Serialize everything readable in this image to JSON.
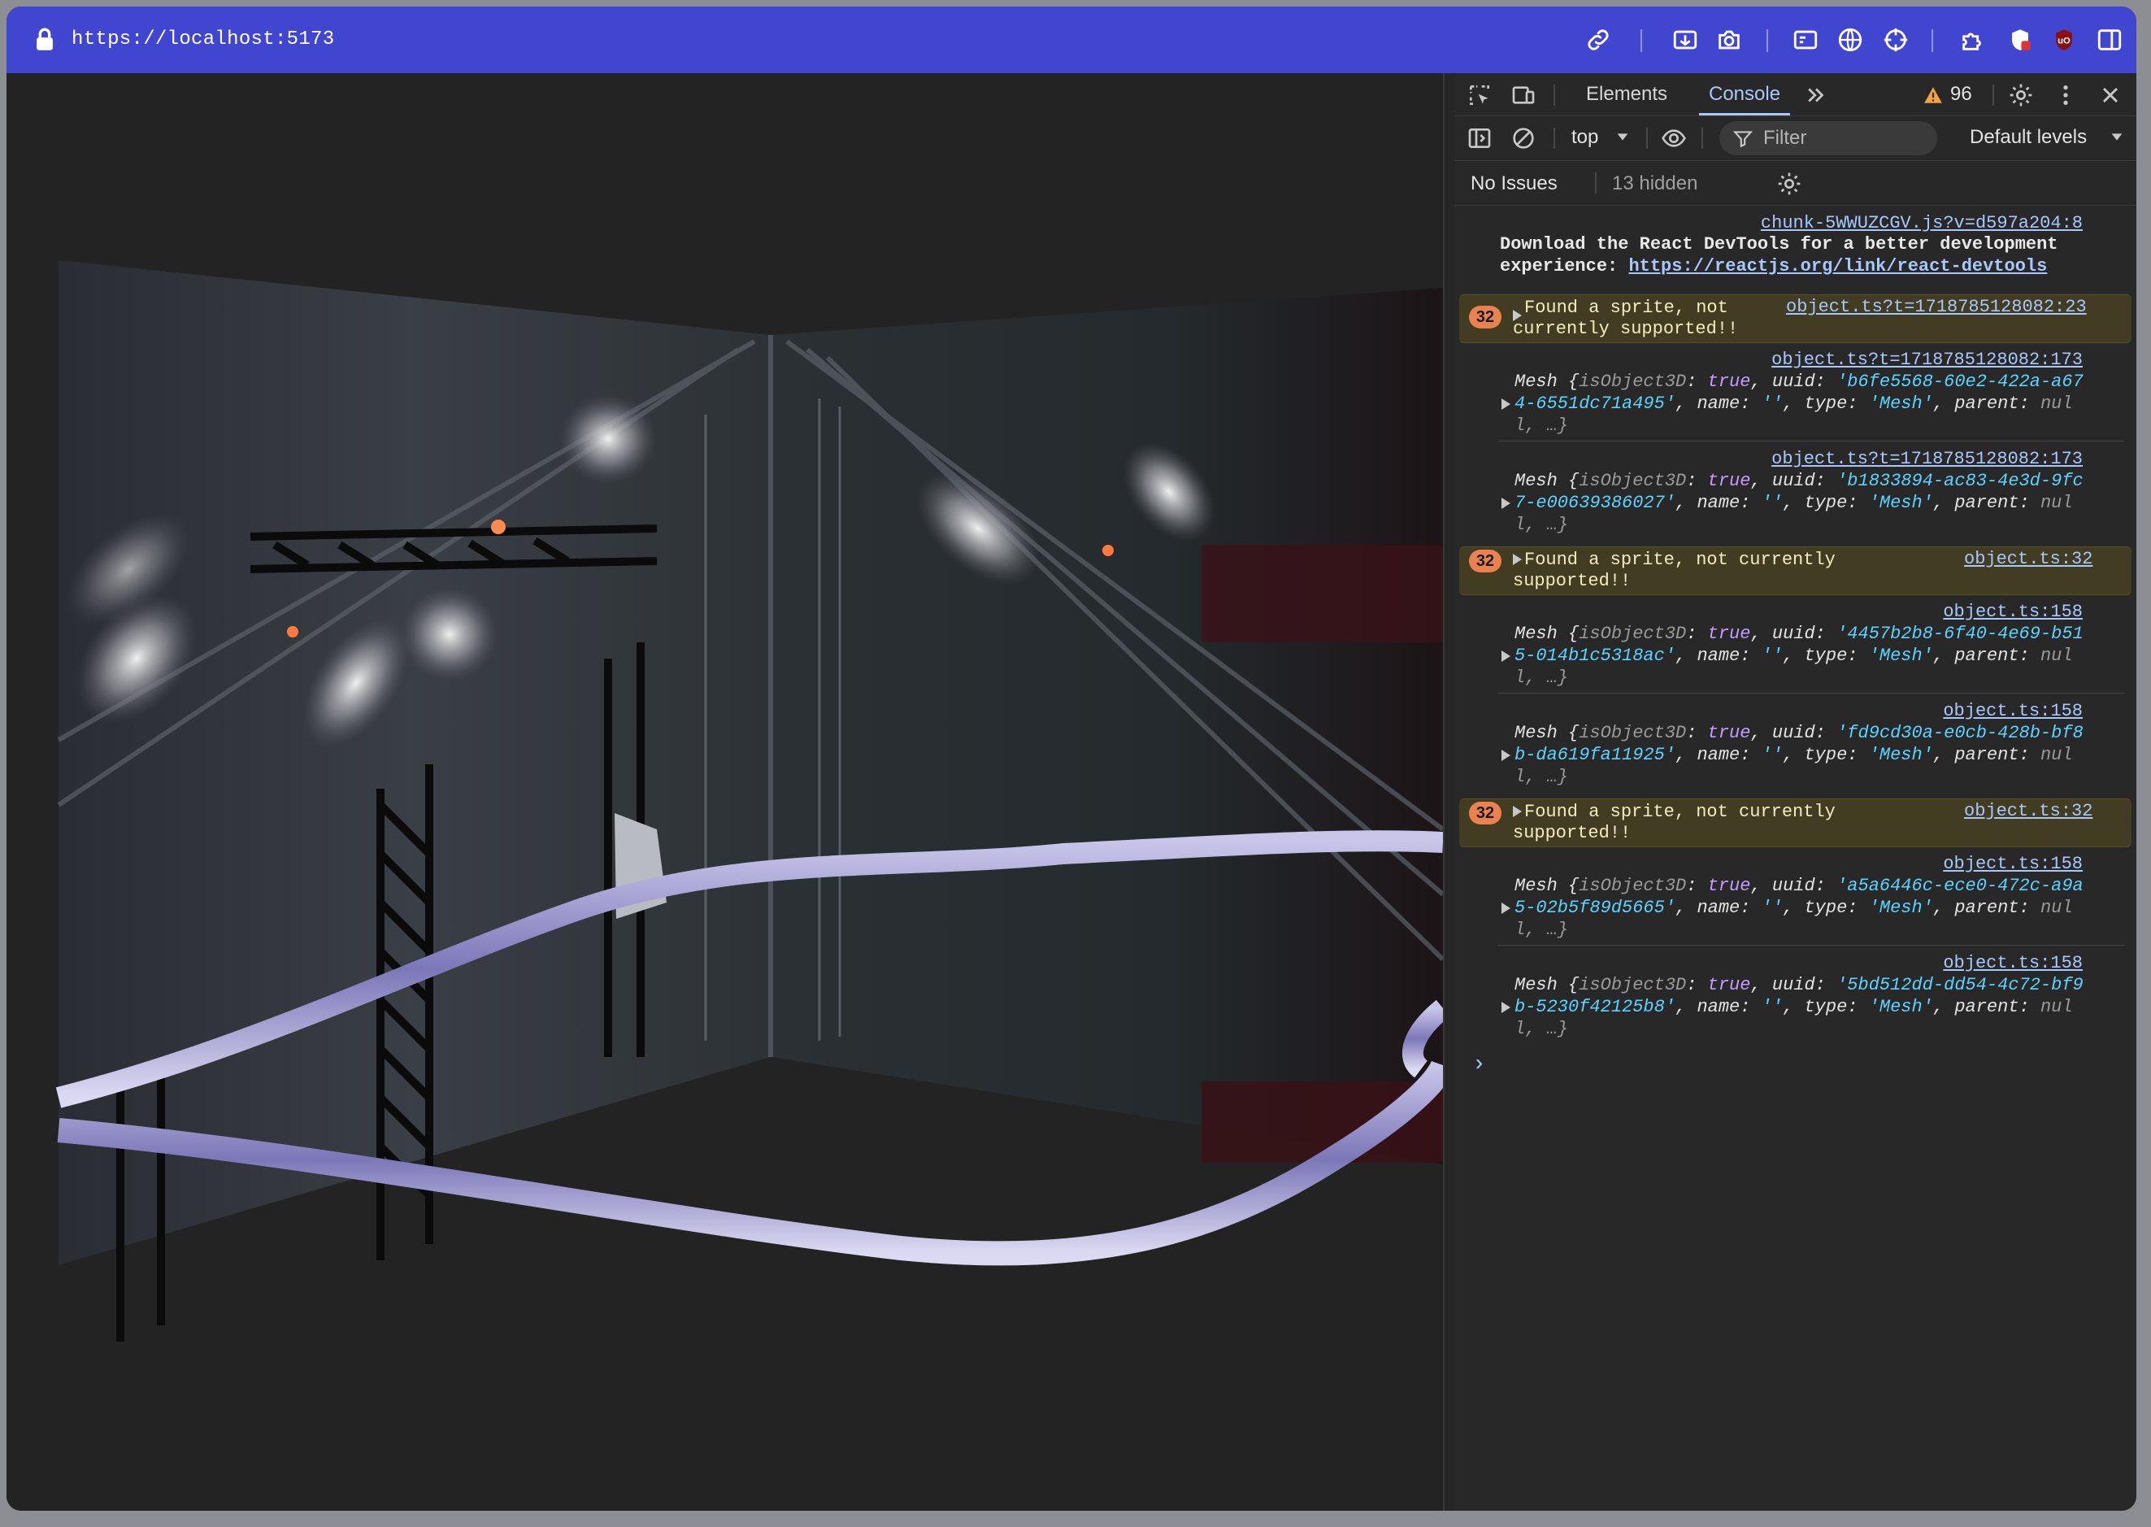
{
  "browser": {
    "url": "https://localhost:5173",
    "toolbar_icons": [
      "link-icon",
      "screenshot-area-icon",
      "camera-icon",
      "terminal-icon",
      "globe-icon",
      "crosshair-icon",
      "extensions-icon",
      "shield-extension-icon",
      "ublock-icon",
      "sidebar-icon"
    ],
    "accent": "#4146d0"
  },
  "devtools": {
    "tabs": {
      "elements": "Elements",
      "console": "Console"
    },
    "warning_count": "96",
    "context": "top",
    "filter_placeholder": "Filter",
    "levels": "Default levels",
    "issues": "No Issues",
    "hidden": "13 hidden"
  },
  "console": {
    "m1": {
      "source": "chunk-5WWUZCGV.js?v=d597a204:8",
      "text1": "Download the React DevTools for a better development",
      "text2a": "experience: ",
      "text2link": "https://reactjs.org/link/react-devtools"
    },
    "w1": {
      "count": "32",
      "line1": "Found a sprite, not",
      "line2": "currently supported!!",
      "source": "object.ts?t=1718785128082:23"
    },
    "mesh1": {
      "source": "object.ts?t=1718785128082:173",
      "uuid_a": "'b6fe5568-60e2-422a-a67",
      "uuid_b": "4-6551dc71a495'"
    },
    "mesh2": {
      "source": "object.ts?t=1718785128082:173",
      "uuid_a": "'b1833894-ac83-4e3d-9fc",
      "uuid_b": "7-e00639386027'"
    },
    "w2": {
      "count": "32",
      "line1": "Found a sprite, not currently",
      "line2": "supported!!",
      "source": "object.ts:32"
    },
    "mesh3": {
      "source": "object.ts:158",
      "uuid_a": "'4457b2b8-6f40-4e69-b51",
      "uuid_b": "5-014b1c5318ac'"
    },
    "mesh4": {
      "source": "object.ts:158",
      "uuid_a": "'fd9cd30a-e0cb-428b-bf8",
      "uuid_b": "b-da619fa11925'"
    },
    "w3": {
      "count": "32",
      "line1": "Found a sprite, not currently",
      "line2": "supported!!",
      "source": "object.ts:32"
    },
    "mesh5": {
      "source": "object.ts:158",
      "uuid_a": "'a5a6446c-ece0-472c-a9a",
      "uuid_b": "5-02b5f89d5665'"
    },
    "mesh6": {
      "source": "object.ts:158",
      "uuid_a": "'5bd512dd-dd54-4c72-bf9",
      "uuid_b": "b-5230f42125b8'"
    },
    "mesh_labels": {
      "mesh": "Mesh {",
      "isObject3D": "isObject3D",
      "colon": ": ",
      "true": "true",
      "comma_uuid": ", uuid: ",
      "name_part": ", name: ",
      "empty_str": "''",
      "type_part": ", type: ",
      "mesh_str": "'Mesh'",
      "parent_part": ", parent: ",
      "nul": "nul",
      "l_end": "l, …}"
    },
    "prompt": "›"
  }
}
